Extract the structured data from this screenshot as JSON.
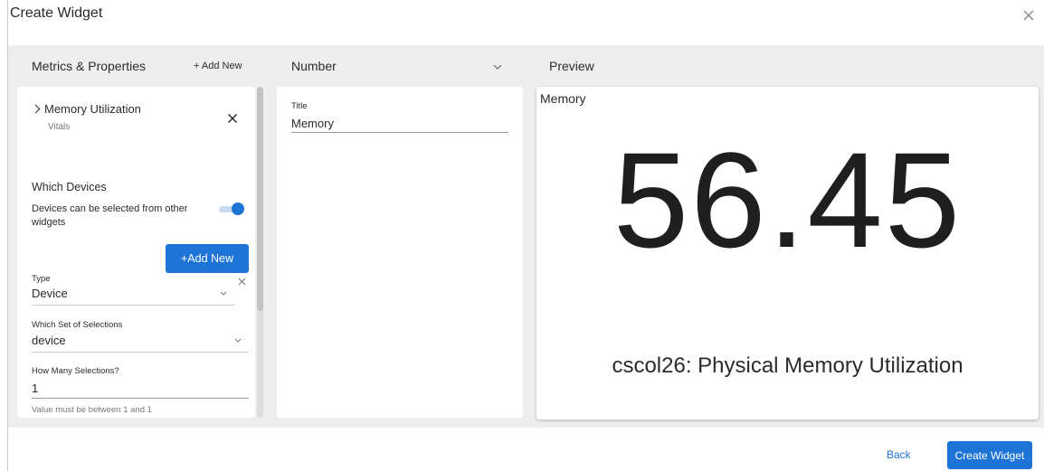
{
  "dialog": {
    "title": "Create Widget"
  },
  "left": {
    "header": "Metrics & Properties",
    "add_new_link": "+ Add New",
    "metric": {
      "name": "Memory Utilization",
      "category": "Vitals"
    },
    "which_devices_heading": "Which Devices",
    "devices_toggle_text": "Devices can be selected from other widgets",
    "devices_toggle_on": true,
    "add_new_button": "+Add New",
    "type": {
      "label": "Type",
      "value": "Device"
    },
    "set": {
      "label": "Which Set of Selections",
      "value": "device"
    },
    "count": {
      "label": "How Many Selections?",
      "value": "1",
      "hint": "Value must be between 1 and 1"
    }
  },
  "middle": {
    "header": "Number",
    "title_label": "Title",
    "title_value": "Memory"
  },
  "preview": {
    "header": "Preview",
    "widget_title": "Memory",
    "value": "56.45",
    "caption": "cscol26: Physical Memory Utilization"
  },
  "footer": {
    "back": "Back",
    "create": "Create Widget"
  },
  "colors": {
    "accent": "#1e73d6",
    "panel_bg": "#eeeeee"
  },
  "icons": {
    "close": "close-icon",
    "metric_expand": "chevron-right-icon",
    "dropdown": "chevron-down-icon"
  }
}
